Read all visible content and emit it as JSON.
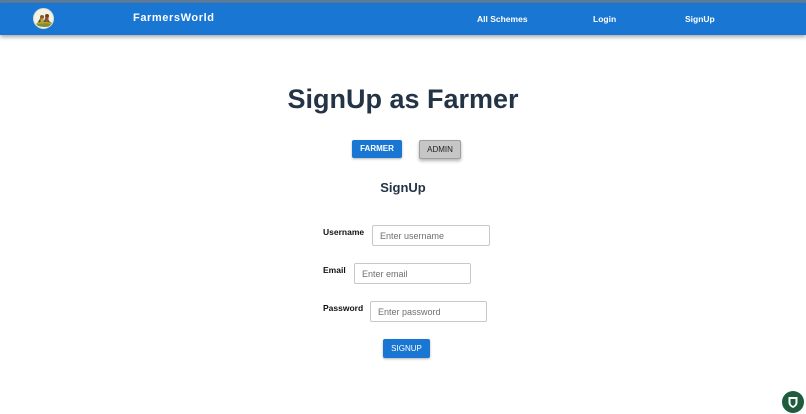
{
  "navbar": {
    "brand": "FarmersWorld",
    "links": [
      "All Schemes",
      "Login",
      "SignUp"
    ],
    "logo_icon": "farmer-logo-icon",
    "color": "#1976d2"
  },
  "page": {
    "title": "SignUp as Farmer",
    "role_buttons": {
      "farmer": "FARMER",
      "admin": "ADMIN"
    },
    "form_title": "SignUp"
  },
  "form": {
    "username": {
      "label": "Username",
      "placeholder": "Enter username"
    },
    "email": {
      "label": "Email",
      "placeholder": "Enter email"
    },
    "password": {
      "label": "Password",
      "placeholder": "Enter password"
    },
    "submit": "SIGNUP"
  },
  "colors": {
    "primary": "#1976d2",
    "heading": "#243447",
    "admin_button": "#c6c6c6",
    "extension_badge": "#1f5c3d"
  },
  "extension": {
    "icon": "shield-extension-icon"
  }
}
